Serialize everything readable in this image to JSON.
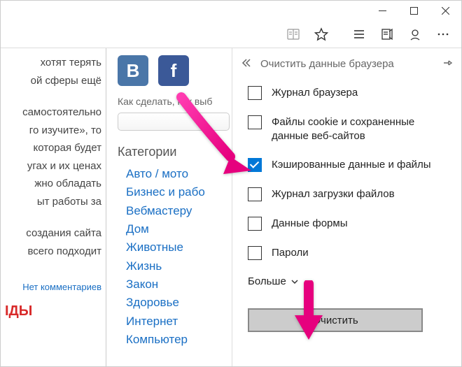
{
  "left_fragments": [
    "хотят терять",
    "ой сферы ещё",
    "",
    "самостоятельно",
    "го изучите», то",
    "которая будет",
    "угах и их ценах",
    "жно обладать",
    "ыт работы за",
    "",
    "создания сайта",
    "всего подходит"
  ],
  "no_comments": "Нет комментариев",
  "red_frag": "ІДЫ",
  "mid_subline": "Как сделать, как выб",
  "categories_header": "Категории",
  "categories": [
    "Авто / мото",
    "Бизнес и рабо",
    "Вебмастеру",
    "Дом",
    "Животные",
    "Жизнь",
    "Закон",
    "Здоровье",
    "Интернет",
    "Компьютер"
  ],
  "panel": {
    "title": "Очистить данные браузера",
    "items": [
      {
        "label": "Журнал браузера",
        "checked": false
      },
      {
        "label": "Файлы cookie и сохраненные данные веб-сайтов",
        "checked": false
      },
      {
        "label": "Кэшированные данные и файлы",
        "checked": true
      },
      {
        "label": "Журнал загрузки файлов",
        "checked": false
      },
      {
        "label": "Данные формы",
        "checked": false
      },
      {
        "label": "Пароли",
        "checked": false
      }
    ],
    "more": "Больше",
    "clear": "Очистить"
  }
}
